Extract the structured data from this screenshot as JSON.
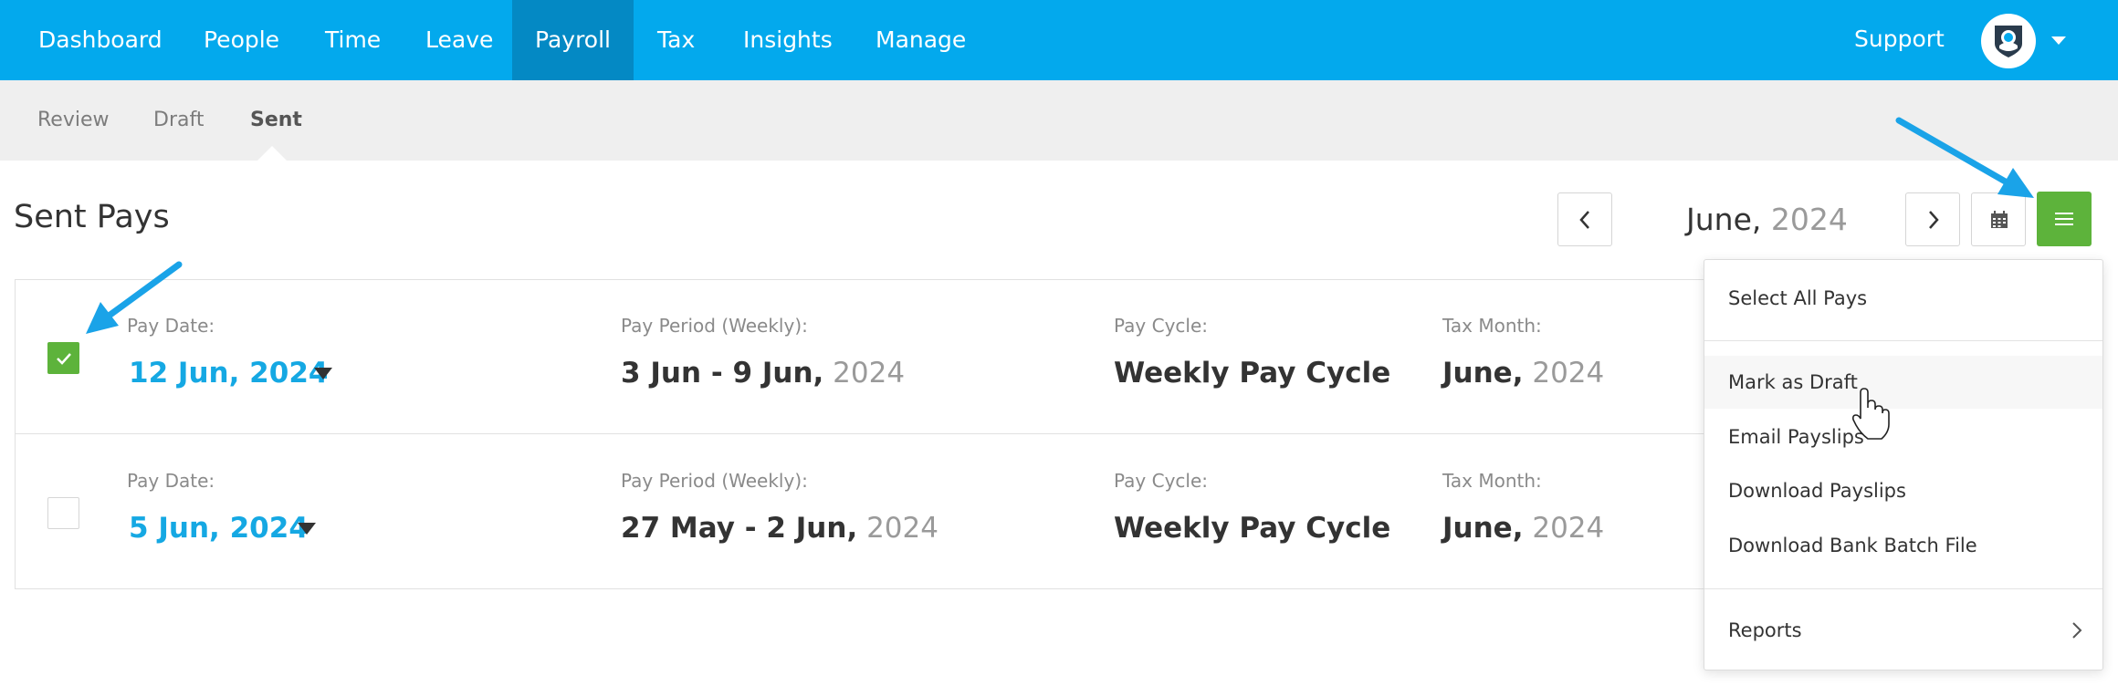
{
  "topnav": {
    "items": [
      "Dashboard",
      "People",
      "Time",
      "Leave",
      "Payroll",
      "Tax",
      "Insights",
      "Manage"
    ],
    "active": "Payroll",
    "support_label": "Support",
    "brand_color": "#03a9ed"
  },
  "subnav": {
    "items": [
      "Review",
      "Draft",
      "Sent"
    ],
    "active": "Sent"
  },
  "page": {
    "title": "Sent Pays",
    "month": "June,",
    "year": "2024"
  },
  "labels": {
    "pay_date": "Pay Date:",
    "pay_period": "Pay Period (Weekly):",
    "pay_cycle": "Pay Cycle:",
    "tax_month": "Tax Month:"
  },
  "pays": [
    {
      "checked": true,
      "pay_date": "12 Jun, 2024",
      "period_main": "3 Jun - 9 Jun,",
      "period_year": "2024",
      "cycle": "Weekly Pay Cycle",
      "tax_month": "June,",
      "tax_year": "2024"
    },
    {
      "checked": false,
      "pay_date": "5 Jun, 2024",
      "period_main": "27 May - 2 Jun,",
      "period_year": "2024",
      "cycle": "Weekly Pay Cycle",
      "tax_month": "June,",
      "tax_year": "2024"
    }
  ],
  "menu": {
    "select_all": "Select All Pays",
    "mark_draft": "Mark as Draft",
    "email_payslips": "Email Payslips",
    "download_payslips": "Download Payslips",
    "download_bank": "Download Bank Batch File",
    "reports": "Reports"
  },
  "icons": {
    "prev": "chevron-left-icon",
    "next": "chevron-right-icon",
    "calendar": "calendar-icon",
    "menu": "hamburger-icon",
    "check": "check-icon",
    "cursor": "hand-pointer-icon"
  },
  "colors": {
    "accent_green": "#5db33b",
    "link_blue": "#15a8e3",
    "annotation_arrow": "#1aa3e8"
  }
}
